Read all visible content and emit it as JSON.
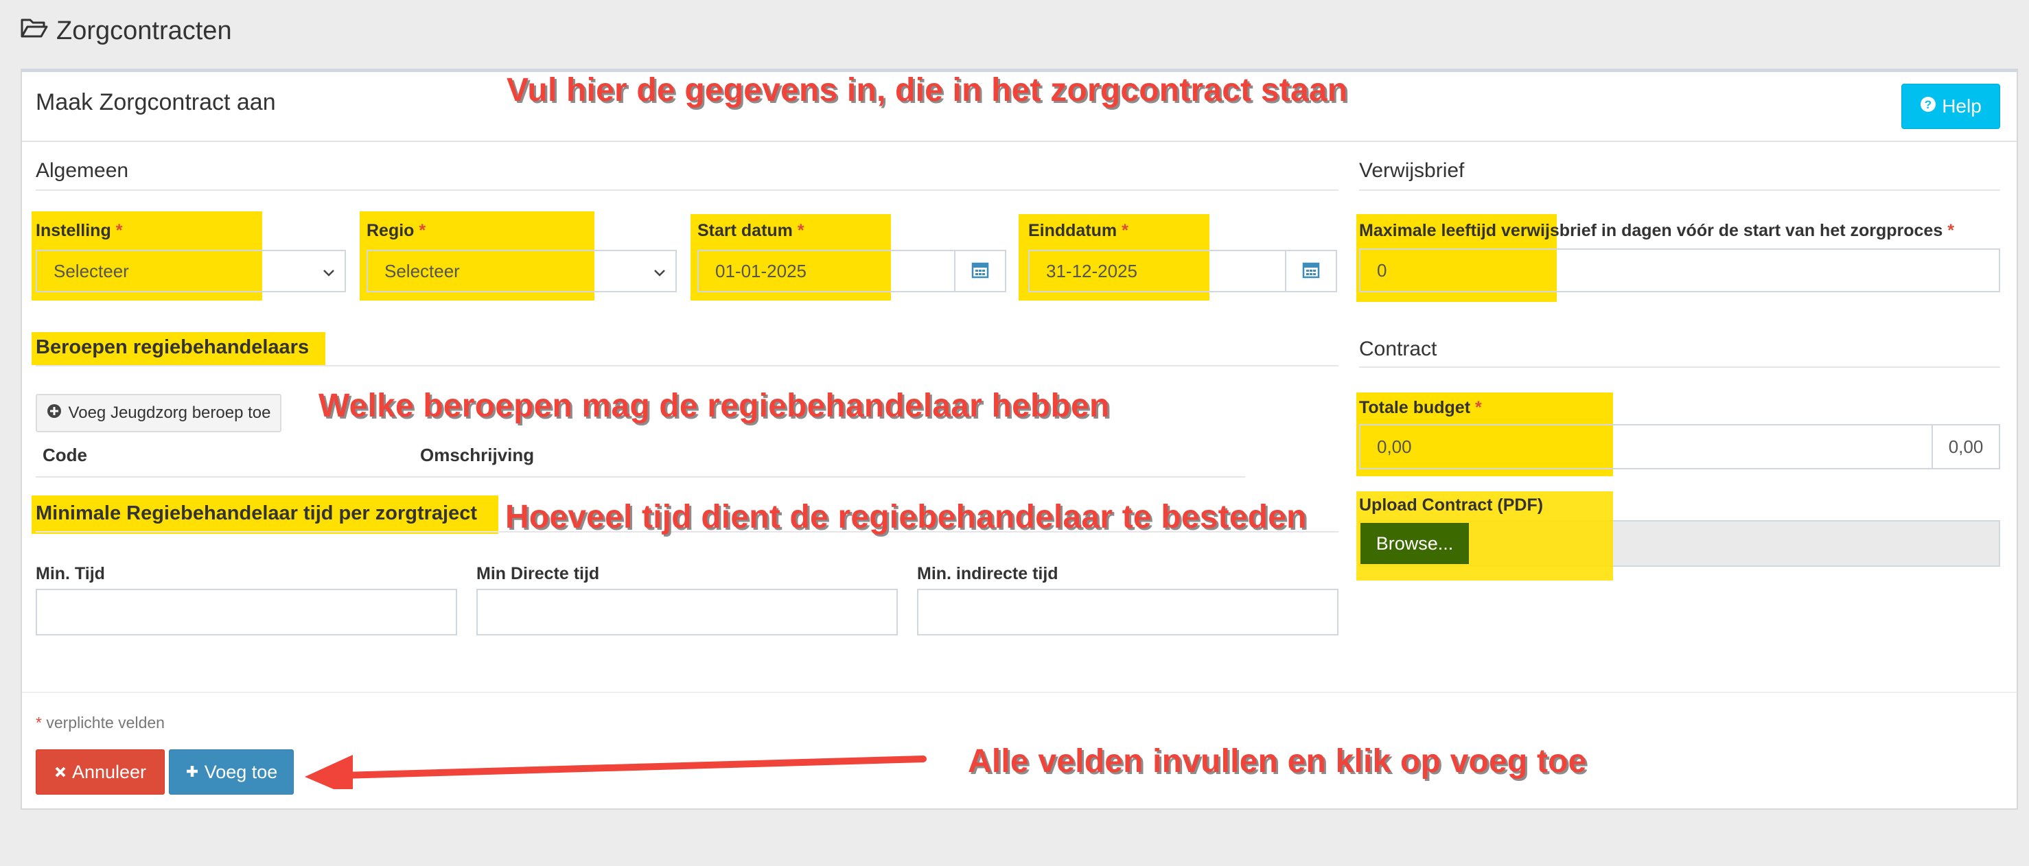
{
  "page": {
    "title": "Zorgcontracten"
  },
  "card": {
    "title": "Maak Zorgcontract aan",
    "help_label": "Help"
  },
  "algemeen": {
    "heading": "Algemeen",
    "instelling": {
      "label": "Instelling",
      "value": "Selecteer"
    },
    "regio": {
      "label": "Regio",
      "value": "Selecteer"
    },
    "start": {
      "label": "Start datum",
      "value": "01-01-2025"
    },
    "eind": {
      "label": "Einddatum",
      "value": "31-12-2025"
    }
  },
  "verwijsbrief": {
    "heading": "Verwijsbrief",
    "max_label": "Maximale leeftijd verwijsbrief in dagen vóór de start van het zorgproces",
    "max_value": "0"
  },
  "beroepen": {
    "heading": "Beroepen regiebehandelaars",
    "add_label": "Voeg Jeugdzorg beroep toe",
    "columns": [
      "Code",
      "Omschrijving"
    ]
  },
  "minimale": {
    "heading": "Minimale Regiebehandelaar tijd per zorgtraject",
    "fields": [
      {
        "label": "Min. Tijd",
        "value": ""
      },
      {
        "label": "Min Directe tijd",
        "value": ""
      },
      {
        "label": "Min. indirecte tijd",
        "value": ""
      }
    ]
  },
  "contract": {
    "heading": "Contract",
    "budget_label": "Totale budget",
    "budget_value": "0,00",
    "budget_addon": "0,00",
    "upload_label": "Upload Contract (PDF)",
    "browse_label": "Browse..."
  },
  "footer": {
    "required_note": "verplichte velden",
    "required_star": "*",
    "cancel_label": "Annuleer",
    "add_label": "Voeg toe"
  },
  "annotations": {
    "top": "Vul hier de gegevens in, die in het zorgcontract staan",
    "beroepen": "Welke beroepen mag de regiebehandelaar hebben",
    "tijd": "Hoeveel tijd dient de regiebehandelaar te besteden",
    "bottom": "Alle velden invullen en klik op voeg toe"
  },
  "colors": {
    "highlight": "#ffe000",
    "annotation": "#f0433a",
    "help_button": "#00c0ef",
    "cancel_button": "#dd4b39",
    "add_button": "#3c8dbc",
    "browse_button": "#3c6a00"
  },
  "icons": {
    "title": "folder-open-icon",
    "help": "question-circle-icon",
    "calendar": "calendar-icon",
    "select": "chevron-down-icon",
    "add": "plus-circle-icon",
    "cancel": "times-icon",
    "plus": "plus-icon"
  }
}
